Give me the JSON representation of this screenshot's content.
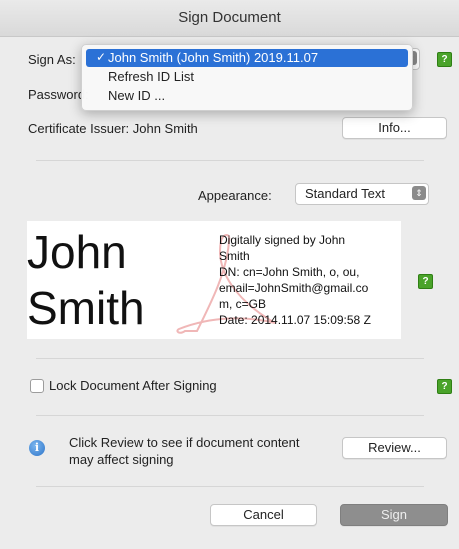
{
  "window": {
    "title": "Sign Document"
  },
  "sign_as": {
    "label": "Sign As:",
    "options": [
      "John Smith (John Smith) 2019.11.07",
      "Refresh ID List",
      "New ID ..."
    ],
    "selected_check": "✓"
  },
  "password": {
    "label": "Password:"
  },
  "certificate": {
    "label": "Certificate Issuer: John Smith",
    "info_button": "Info..."
  },
  "appearance": {
    "label": "Appearance:",
    "value": "Standard Text"
  },
  "signature_preview": {
    "name_line1": "John",
    "name_line2": "Smith",
    "details": [
      "Digitally signed by John",
      "Smith",
      "DN: cn=John Smith, o, ou,",
      "email=JohnSmith@gmail.co",
      "m, c=GB",
      "Date: 2014.11.07 15:09:58 Z"
    ]
  },
  "lock": {
    "label": "Lock Document After Signing"
  },
  "review": {
    "text_line1": "Click Review to see if document content",
    "text_line2": "may affect signing",
    "button": "Review..."
  },
  "footer": {
    "cancel": "Cancel",
    "sign": "Sign"
  },
  "help_icon_glyph": "?",
  "info_icon_glyph": "i",
  "icons": {
    "help": "help-icon",
    "info": "info-icon",
    "chevron": "chevron-up-down-icon",
    "check": "checkmark-icon"
  },
  "colors": {
    "help_green": "#4aa32a",
    "menu_highlight": "#2b71d6",
    "sign_button": "#8e8e8e",
    "info_blue": "#2d74c9"
  }
}
